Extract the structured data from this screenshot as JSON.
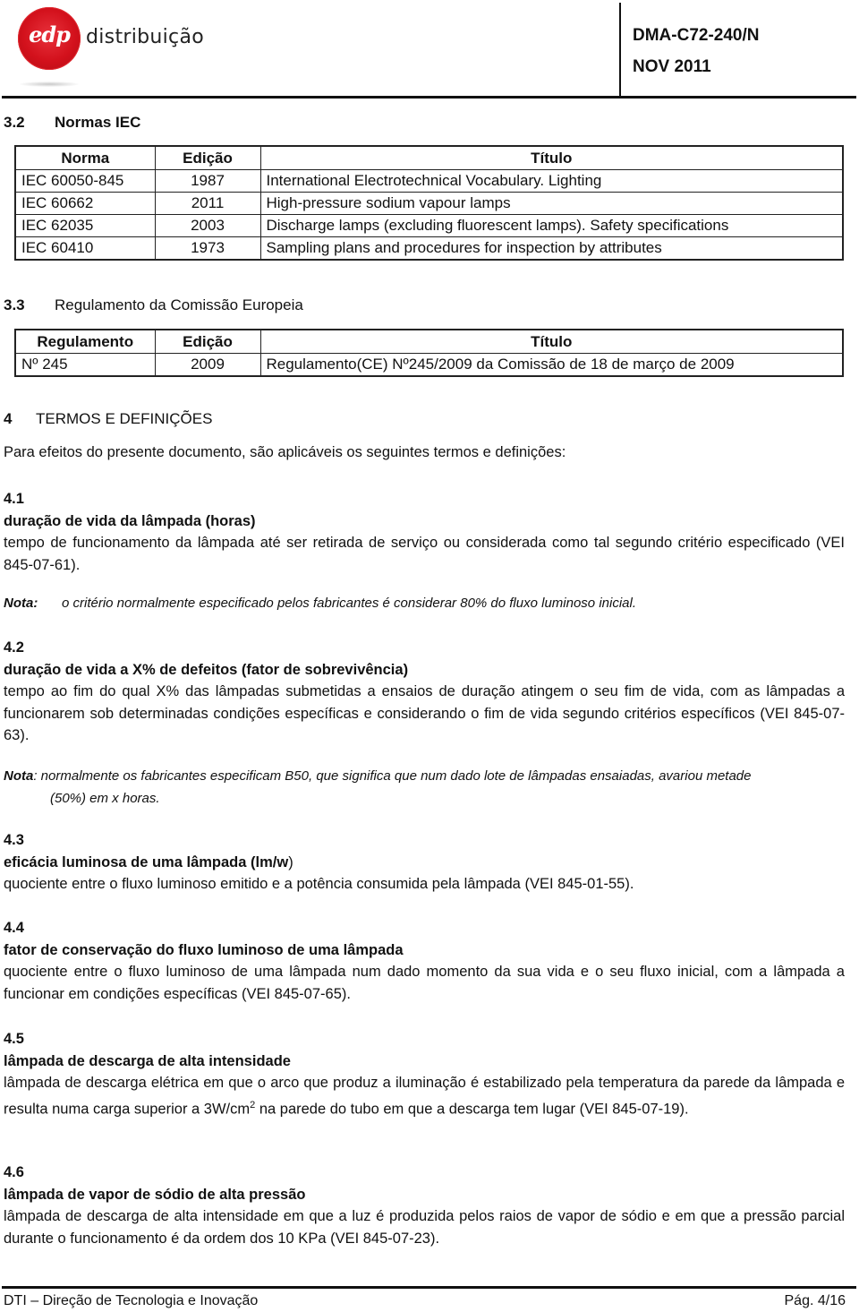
{
  "header": {
    "logo_text": "edp",
    "brand": "distribuição",
    "doc_code": "DMA-C72-240/N",
    "doc_date": "NOV 2011"
  },
  "section_3_2": {
    "number": "3.2",
    "title": "Normas IEC",
    "table": {
      "headers": [
        "Norma",
        "Edição",
        "Título"
      ],
      "rows": [
        [
          "IEC 60050-845",
          "1987",
          "International Electrotechnical Vocabulary. Lighting"
        ],
        [
          "IEC 60662",
          "2011",
          "High-pressure sodium vapour lamps"
        ],
        [
          "IEC 62035",
          "2003",
          "Discharge lamps (excluding fluorescent lamps).  Safety specifications"
        ],
        [
          "IEC 60410",
          "1973",
          "Sampling plans and procedures for inspection by attributes"
        ]
      ]
    }
  },
  "section_3_3": {
    "number": "3.3",
    "title": "Regulamento da Comissão Europeia",
    "table": {
      "headers": [
        "Regulamento",
        "Edição",
        "Título"
      ],
      "rows": [
        [
          "Nº 245",
          "2009",
          "Regulamento(CE) Nº245/2009 da Comissão de 18 de março de 2009"
        ]
      ]
    }
  },
  "section_4": {
    "number": "4",
    "title": "TERMOS E DEFINIÇÕES",
    "intro": "Para efeitos do presente documento, são aplicáveis os seguintes termos e definições:",
    "terms": [
      {
        "number": "4.1",
        "term": "duração de vida da lâmpada (horas)",
        "definition": "tempo de funcionamento da lâmpada até ser retirada de serviço ou considerada como tal segundo critério especificado (VEI 845-07-61).",
        "note_label": "Nota:",
        "note": "o critério normalmente especificado pelos fabricantes é considerar 80% do fluxo luminoso inicial."
      },
      {
        "number": "4.2",
        "term": "duração de vida a X% de defeitos (fator de sobrevivência)",
        "definition": "tempo ao fim do qual X% das lâmpadas submetidas a ensaios de duração atingem o seu fim de vida, com as lâmpadas a funcionarem sob determinadas condições específicas e considerando o fim de vida segundo critérios específicos (VEI 845-07-63).",
        "note_label": "Nota",
        "note": ": normalmente os fabricantes especificam B50, que significa que num dado lote de lâmpadas ensaiadas, avariou metade",
        "note_cont": "(50%) em x horas."
      },
      {
        "number": "4.3",
        "term": "eficácia luminosa de uma lâmpada (lm/w",
        "term_suffix": ")",
        "definition": "quociente entre o fluxo luminoso emitido e a potência consumida pela lâmpada (VEI 845-01-55)."
      },
      {
        "number": "4.4",
        "term": "fator de conservação do fluxo luminoso de uma lâmpada",
        "definition": "quociente entre o fluxo luminoso de uma lâmpada num dado momento da sua vida e o seu fluxo inicial, com a lâmpada a funcionar em condições específicas (VEI 845-07-65)."
      },
      {
        "number": "4.5",
        "term": "lâmpada de descarga de alta intensidade",
        "definition_a": "lâmpada de descarga elétrica em que o arco que produz a iluminação é estabilizado pela temperatura da parede da lâmpada e resulta numa carga superior a 3W/cm",
        "definition_sup": "2",
        "definition_b": " na parede do tubo em que a descarga tem lugar (VEI 845-07-19)."
      },
      {
        "number": "4.6",
        "term": "lâmpada de vapor de sódio de alta pressão",
        "definition": "lâmpada de descarga de alta intensidade em que a luz é produzida pelos raios de vapor de sódio e em que a pressão parcial durante o funcionamento é da ordem dos 10 KPa (VEI 845-07-23)."
      }
    ]
  },
  "footer": {
    "left": "DTI – Direção de Tecnologia e Inovação",
    "right": "Pág. 4/16"
  },
  "colors": {
    "brand_red": "#d3111c",
    "text": "#111111"
  }
}
